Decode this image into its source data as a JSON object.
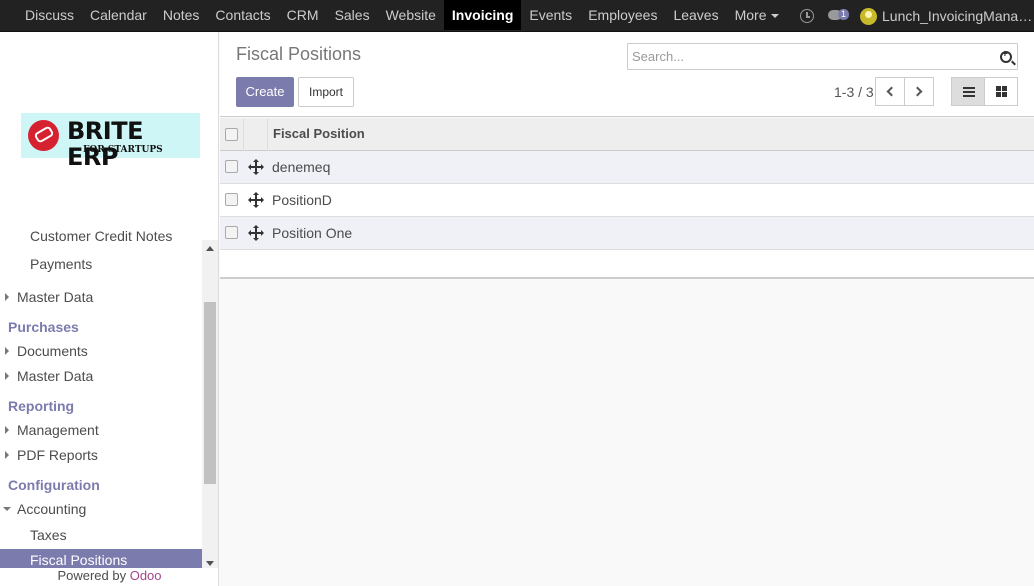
{
  "topbar": {
    "menu": [
      {
        "label": "Discuss"
      },
      {
        "label": "Calendar"
      },
      {
        "label": "Notes"
      },
      {
        "label": "Contacts"
      },
      {
        "label": "CRM"
      },
      {
        "label": "Sales"
      },
      {
        "label": "Website"
      },
      {
        "label": "Invoicing",
        "active": true
      },
      {
        "label": "Events"
      },
      {
        "label": "Employees"
      },
      {
        "label": "Leaves"
      }
    ],
    "more_label": "More",
    "chat_badge": "1",
    "user_name": "Lunch_InvoicingManag..."
  },
  "sidebar": {
    "logo_main": "BRITE ERP",
    "logo_sub": "FOR STARTUPS",
    "items": [
      {
        "label": "Customer Credit Notes",
        "kind": "sub"
      },
      {
        "label": "Payments",
        "kind": "sub"
      },
      {
        "label": "Master Data",
        "kind": "lvl"
      },
      {
        "label": "Purchases",
        "kind": "head"
      },
      {
        "label": "Documents",
        "kind": "lvl"
      },
      {
        "label": "Master Data",
        "kind": "lvl"
      },
      {
        "label": "Reporting",
        "kind": "head"
      },
      {
        "label": "Management",
        "kind": "lvl"
      },
      {
        "label": "PDF Reports",
        "kind": "lvl"
      },
      {
        "label": "Configuration",
        "kind": "head"
      },
      {
        "label": "Accounting",
        "kind": "lvl"
      },
      {
        "label": "Taxes",
        "kind": "sub"
      },
      {
        "label": "Fiscal Positions",
        "kind": "sub"
      }
    ],
    "powered_prefix": "Powered by ",
    "powered_brand": "Odoo"
  },
  "main": {
    "title": "Fiscal Positions",
    "search_placeholder": "Search...",
    "create_label": "Create",
    "import_label": "Import",
    "pager": "1-3 / 3",
    "table": {
      "column": "Fiscal Position",
      "rows": [
        {
          "name": "denemeq"
        },
        {
          "name": "PositionD"
        },
        {
          "name": "Position One"
        }
      ]
    }
  },
  "colors": {
    "brand": "#7c7bad",
    "topbar": "#222222",
    "odoo": "#a24689"
  }
}
